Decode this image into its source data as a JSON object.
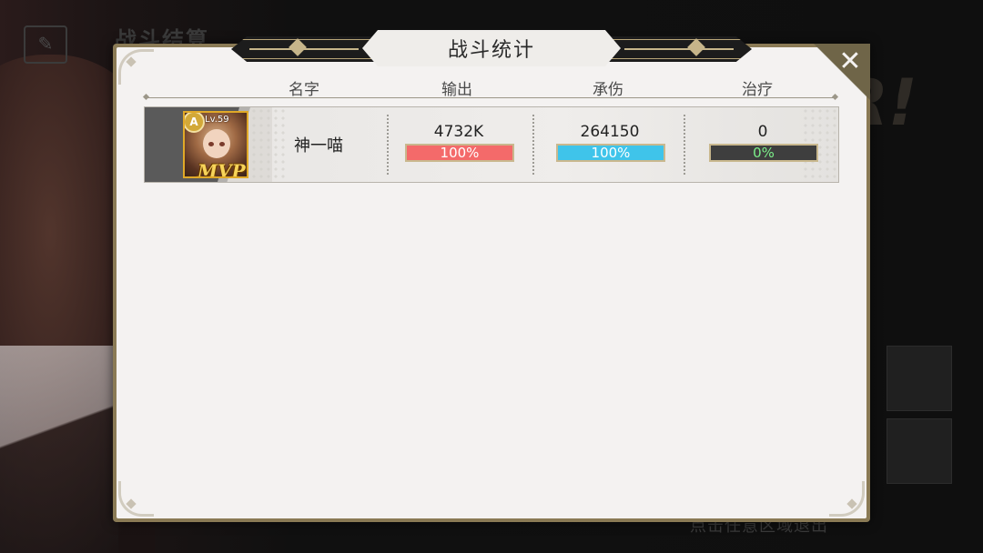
{
  "background": {
    "title": "战斗结算",
    "hint": "点击任意区域退出"
  },
  "dialog": {
    "title": "战斗统计",
    "close_label": "✕"
  },
  "headers": {
    "name": "名字",
    "output": "输出",
    "damage_taken": "承伤",
    "healing": "治疗"
  },
  "players": [
    {
      "level": "Lv.59",
      "rank_badge": "A",
      "mvp": "MVP",
      "name": "神一喵",
      "output": {
        "value": "4732K",
        "percent_text": "100%",
        "percent": 100
      },
      "damage_taken": {
        "value": "264150",
        "percent_text": "100%",
        "percent": 100
      },
      "healing": {
        "value": "0",
        "percent_text": "0%",
        "percent": 0
      }
    }
  ],
  "colors": {
    "output_bar": "#f46a6a",
    "damage_bar": "#3fc4ea",
    "healing_bar": "#3e3e3e",
    "healing_text": "#7cf08a",
    "frame_gold": "#c6b58a"
  }
}
